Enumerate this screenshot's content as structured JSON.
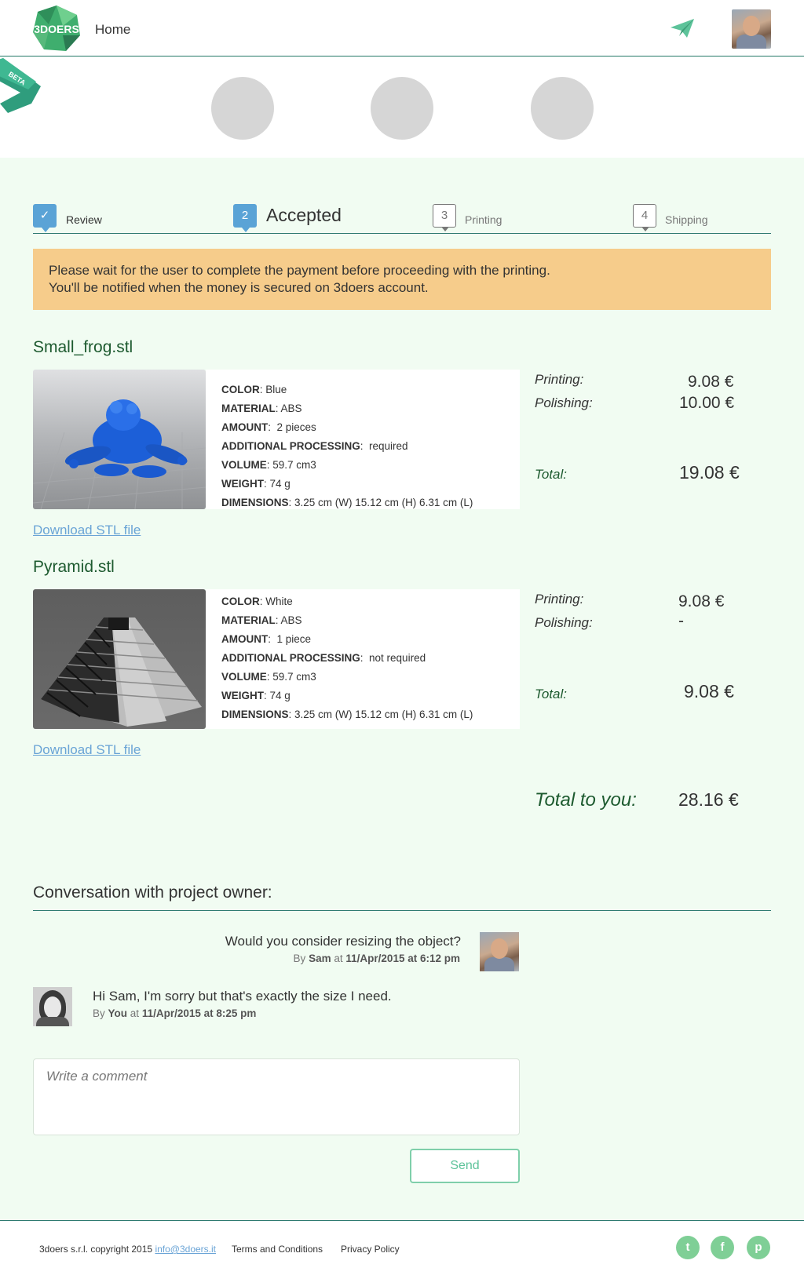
{
  "brand": {
    "logo_text": "3DOERS",
    "beta_label": "BETA",
    "accent": "#2e7a70",
    "page_bg": "#f1fcf2",
    "notice_bg": "#f6cc8b",
    "link_color": "#6aa4d6"
  },
  "nav": {
    "home_label": "Home",
    "send_icon": "paper-plane-icon"
  },
  "steps": [
    {
      "number": "",
      "label": "Review",
      "state": "done"
    },
    {
      "number": "2",
      "label": "Accepted",
      "state": "active"
    },
    {
      "number": "3",
      "label": "Printing",
      "state": "pending"
    },
    {
      "number": "4",
      "label": "Shipping",
      "state": "pending"
    }
  ],
  "notice": {
    "line1": "Please wait for the user to complete the payment before proceeding with the printing.",
    "line2": "You'll be notified when the money is secured on 3doers account."
  },
  "labels": {
    "color": "COLOR",
    "material": "MATERIAL",
    "amount": "AMOUNT",
    "additional": "ADDITIONAL PROCESSING",
    "volume": "VOLUME",
    "weight": "WEIGHT",
    "dimensions": "DIMENSIONS",
    "printing": "Printing:",
    "polishing": "Polishing:",
    "total": "Total:",
    "download": "Download STL file"
  },
  "items": [
    {
      "name": "Small_frog.stl",
      "color": "Blue",
      "material": "ABS",
      "amount": "2 pieces",
      "additional": "required",
      "volume": "59.7 cm3",
      "weight": "74 g",
      "dimensions": "3.25 cm (W) 15.12 cm (H) 6.31 cm (L)",
      "printing_price": "9.08 €",
      "polishing_price": "10.00 €",
      "total": "19.08 €"
    },
    {
      "name": "Pyramid.stl",
      "color": "White",
      "material": "ABS",
      "amount": "1 piece",
      "additional": "not required",
      "volume": "59.7 cm3",
      "weight": "74 g",
      "dimensions": "3.25 cm (W) 15.12 cm (H) 6.31 cm (L)",
      "printing_price": "9.08 €",
      "polishing_price": "-",
      "total": "9.08 €"
    }
  ],
  "grand_total": {
    "label": "Total to you:",
    "value": "28.16 €"
  },
  "conversation": {
    "title": "Conversation with project owner:",
    "messages": [
      {
        "text": "Would you consider resizing the object?",
        "by_prefix": "By",
        "author": "Sam",
        "at": "at",
        "date": "11/Apr/2015 at 6:12 pm"
      },
      {
        "text": "Hi Sam, I'm sorry but that's exactly the size I need.",
        "by_prefix": "By",
        "author": "You",
        "at": "at",
        "date": "11/Apr/2015 at 8:25 pm"
      }
    ],
    "comment_placeholder": "Write a comment",
    "send_label": "Send"
  },
  "footer": {
    "copyright": "3doers s.r.l. copyright 2015",
    "email": "info@3doers.it",
    "terms": "Terms and Conditions",
    "privacy": "Privacy Policy",
    "social": [
      {
        "icon": "twitter-icon",
        "glyph": "t"
      },
      {
        "icon": "facebook-icon",
        "glyph": "f"
      },
      {
        "icon": "pinterest-icon",
        "glyph": "p"
      }
    ]
  }
}
